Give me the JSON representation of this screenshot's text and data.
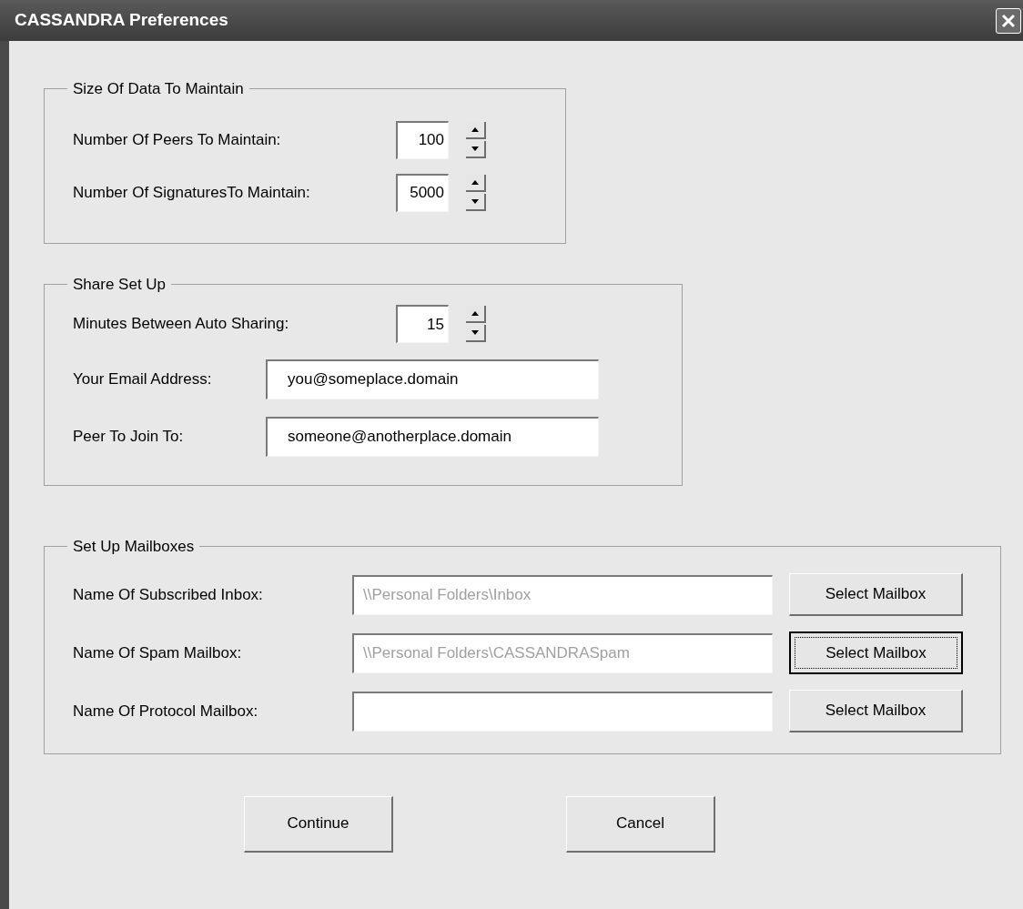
{
  "window": {
    "title": "CASSANDRA Preferences"
  },
  "groups": [
    {
      "title": "Size Of Data To Maintain",
      "rows": [
        {
          "kind": "spinner",
          "label": "Number Of Peers To Maintain:",
          "value": "100"
        },
        {
          "kind": "spinner",
          "label": "Number Of SignaturesTo Maintain:",
          "value": "5000"
        }
      ]
    },
    {
      "title": "Share Set Up",
      "rows": [
        {
          "kind": "spinner",
          "label": "Minutes Between Auto Sharing:",
          "value": "15"
        },
        {
          "kind": "text",
          "label": "Your Email Address:",
          "value": "you@someplace.domain",
          "disabled": false
        },
        {
          "kind": "text",
          "label": "Peer To Join To:",
          "value": "someone@anotherplace.domain",
          "disabled": false
        }
      ]
    },
    {
      "title": "Set Up Mailboxes",
      "rows": [
        {
          "kind": "mailbox",
          "label": "Name Of Subscribed Inbox:",
          "value": "\\\\Personal Folders\\Inbox",
          "disabled": true,
          "button": {
            "label": "Select Mailbox",
            "focused": false
          }
        },
        {
          "kind": "mailbox",
          "label": "Name Of Spam Mailbox:",
          "value": "\\\\Personal Folders\\CASSANDRASpam",
          "disabled": true,
          "button": {
            "label": "Select Mailbox",
            "focused": true
          }
        },
        {
          "kind": "mailbox",
          "label": "Name Of Protocol Mailbox:",
          "button": {
            "label": "Select Mailbox",
            "focused": false
          }
        }
      ]
    }
  ],
  "buttons": [
    "Continue",
    "Cancel"
  ]
}
